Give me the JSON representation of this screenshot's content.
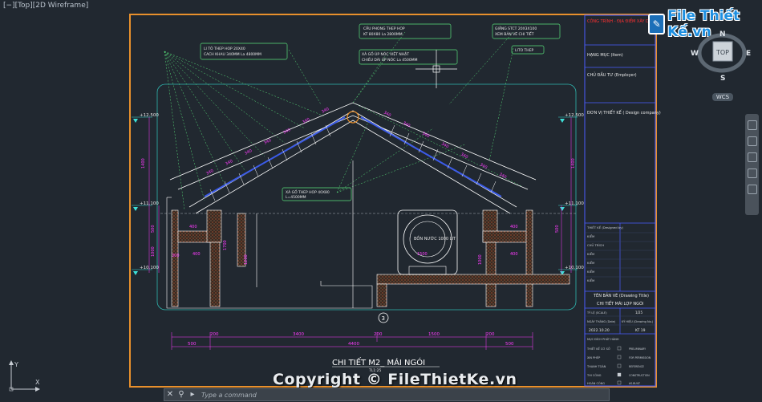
{
  "viewport": {
    "label": "[−][Top][2D Wireframe]"
  },
  "watermark": {
    "logo_text": "File Thiết Kế.vn",
    "copyright": "Copyright © FileThietKe.vn"
  },
  "viewcube": {
    "north": "N",
    "south": "S",
    "east": "E",
    "west": "W",
    "face": "TOP",
    "wcs": "WCS"
  },
  "command": {
    "placeholder": "Type a command"
  },
  "drawing": {
    "title": "CHI TIẾT M2_ MÁI NGÓI",
    "scale": "TL1:25",
    "section_marker": "3",
    "tank_label": "BỒN NƯỚC 1000 LIT",
    "levels": [
      "+12.500",
      "+11.100",
      "+10.100"
    ],
    "callouts": [
      "LI TÔ THEP HOP 20X40\nCACH KHAU 340MM La 4800MM",
      "CẦU PHONG THEP HOP\nKT 80X80 La 2800MM",
      "XÀ GỐ ÙP NÓC VIỆT NHẬT\nCHIỀU DÀI ÙP NÓC La 4500MM",
      "GIẰNG STCT 20X3X100\nXEM BẢN VẼ CHI TIẾT",
      "LITO THEP",
      "XÀ GỐ THEP HOP 40X80\nL=4500MM"
    ],
    "dims_bottom": [
      "200",
      "3400",
      "200",
      "1500",
      "200"
    ],
    "dims_total": "4400",
    "dims_side": [
      "500",
      "500"
    ],
    "rafter_dims": [
      "340",
      "340",
      "340",
      "340",
      "340",
      "340",
      "340",
      "340",
      "340",
      "340"
    ],
    "misc_dims": [
      "400",
      "900",
      "300",
      "1700",
      "1200",
      "200",
      "300",
      "1000",
      "400",
      "1000",
      "900",
      "400",
      "1500"
    ]
  },
  "title_block": {
    "project": "CÔNG TRÌNH - ĐỊA ĐIỂM XÂY DỰNG",
    "item": "HẠNG MỤC (Item)",
    "owner": "CHỦ ĐẦU TƯ (Employer)",
    "designer": "ĐƠN VỊ THIẾT KẾ ( Design company)",
    "design_team": "THIẾT KẾ (Designed by)",
    "team_rows": [
      "KIỂM",
      "CHỦ TRÌCH",
      "KIỂM",
      "KIỂM",
      "KIỂM",
      "KIỂM"
    ],
    "drawing_title_label": "TÊN BẢN VẼ (Drawing Title)",
    "drawing_title": "CHI TIẾT MÁI LỢP NGÓI",
    "scale_label": "TỶ LỆ (SCALE)",
    "scale_value": "1/25",
    "date_label": "NGÀY THÁNG (Date)",
    "date_value": "2022.10.20",
    "sheet_label": "KÝ HIỆU (Drawing No.)",
    "sheet_value": "KT 19",
    "stages": [
      "THIẾT KẾ CƠ SỞ",
      "XIN PHÉP",
      "THANH TOÁN",
      "THI CÔNG",
      "HOÀN CÔNG"
    ],
    "stages_en": [
      "PRELIMINARY",
      "FOR PERMISSION",
      "REFERENCE",
      "CONSTRUCTION",
      "AS-BUILT"
    ],
    "stage_header": "MỤC ĐÍCH PHÁT HÀNH"
  },
  "colors": {
    "frame": "#e8902c",
    "dim": "#ff3bff",
    "callout": "#5cff88",
    "lines": "#ffffff",
    "hatch": "#d9663a",
    "cyan": "#3de0d8",
    "blue": "#3b5be8"
  }
}
